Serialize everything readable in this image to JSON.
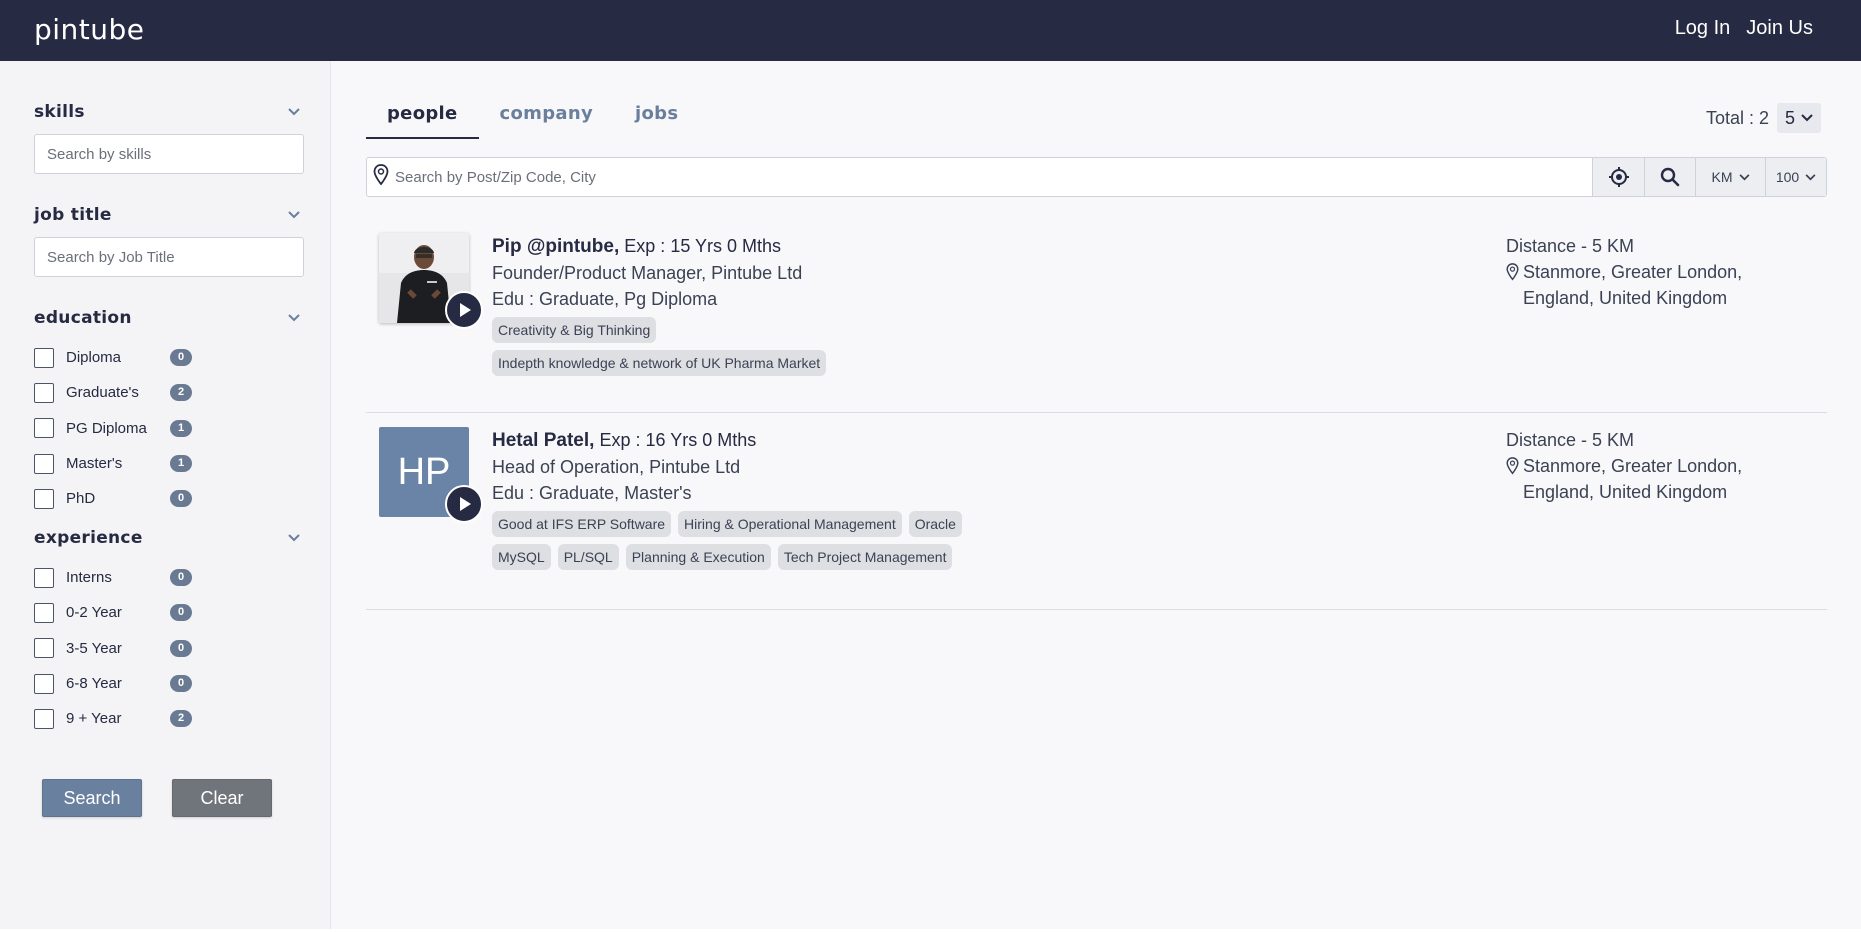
{
  "header": {
    "logo": "pintube",
    "login": "Log In",
    "join": "Join Us"
  },
  "sidebar": {
    "skills": {
      "title": "skills",
      "placeholder": "Search by skills"
    },
    "job_title": {
      "title": "job title",
      "placeholder": "Search by Job Title"
    },
    "education": {
      "title": "education",
      "items": [
        {
          "label": "Diploma",
          "count": "0"
        },
        {
          "label": "Graduate's",
          "count": "2"
        },
        {
          "label": "PG Diploma",
          "count": "1"
        },
        {
          "label": "Master's",
          "count": "1"
        },
        {
          "label": "PhD",
          "count": "0"
        }
      ]
    },
    "experience": {
      "title": "experience",
      "items": [
        {
          "label": "Interns",
          "count": "0"
        },
        {
          "label": "0-2 Year",
          "count": "0"
        },
        {
          "label": "3-5 Year",
          "count": "0"
        },
        {
          "label": "6-8 Year",
          "count": "0"
        },
        {
          "label": "9 + Year",
          "count": "2"
        }
      ]
    },
    "search_button": "Search",
    "clear_button": "Clear"
  },
  "main": {
    "tabs": [
      {
        "label": "people",
        "active": true
      },
      {
        "label": "company",
        "active": false
      },
      {
        "label": "jobs",
        "active": false
      }
    ],
    "total": "Total : 2",
    "page_size": "5",
    "location_placeholder": "Search by Post/Zip Code, City",
    "unit": "KM",
    "radius": "100"
  },
  "results": [
    {
      "name": "Pip @pintube,",
      "exp_label": "Exp :",
      "exp": "15 Yrs 0 Mths",
      "title": "Founder/Product Manager, Pintube Ltd",
      "edu_label": "Edu :",
      "edu": "Graduate, Pg Diploma",
      "tags": [
        "Creativity & Big Thinking",
        "Indepth knowledge & network of UK Pharma Market"
      ],
      "distance": "Distance -  5 KM",
      "address": "Stanmore, Greater London, England, United Kingdom",
      "avatar_type": "photo"
    },
    {
      "name": "Hetal Patel,",
      "exp_label": "Exp :",
      "exp": "16 Yrs 0 Mths",
      "title": "Head of Operation, Pintube Ltd",
      "edu_label": "Edu :",
      "edu": "Graduate, Master's",
      "tags": [
        "Good at IFS ERP Software",
        "Hiring & Operational Management",
        "Oracle",
        "MySQL",
        "PL/SQL",
        "Planning & Execution",
        "Tech Project Management"
      ],
      "distance": "Distance -  5 KM",
      "address": "Stanmore, Greater London, England, United Kingdom",
      "avatar_type": "initials",
      "initials": "HP"
    }
  ],
  "colors": {
    "header_bg": "#262a42",
    "accent": "#69809f",
    "badge": "#6a7a93",
    "avatar_initials_bg": "#6a84a8"
  }
}
